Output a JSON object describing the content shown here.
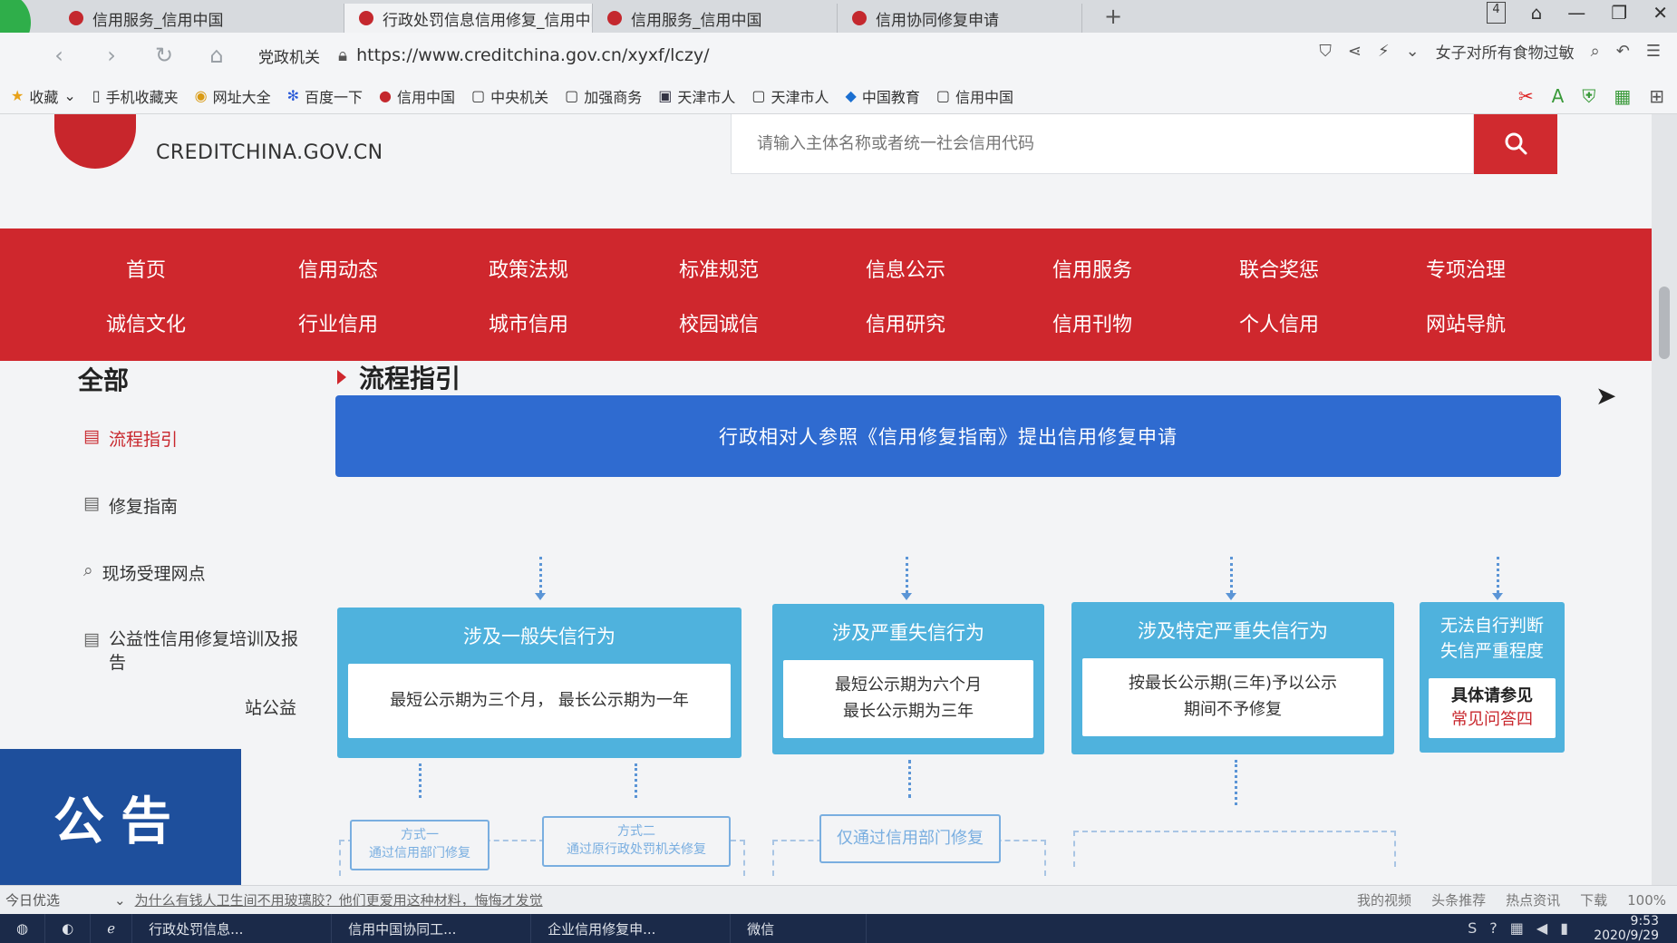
{
  "tabs": [
    {
      "label": "信用服务_信用中国",
      "active": false
    },
    {
      "label": "行政处罚信息信用修复_信用中国",
      "active": true,
      "close": "×"
    },
    {
      "label": "信用服务_信用中国",
      "active": false
    },
    {
      "label": "信用协同修复申请",
      "active": false
    }
  ],
  "new_tab": "+",
  "window": {
    "tab_count": "4"
  },
  "address": {
    "tag": "党政机关",
    "url": "https://www.creditchina.gov.cn/xyxf/lczy/",
    "search_hint": "女子对所有食物过敏"
  },
  "bookmarks": [
    "收藏",
    "手机收藏夹",
    "网址大全",
    "百度一下",
    "信用中国",
    "中央机关",
    "加强商务",
    "天津市人",
    "天津市人",
    "中国教育",
    "信用中国"
  ],
  "site": {
    "domain": "CREDITCHINA.GOV.CN"
  },
  "search": {
    "placeholder": "请输入主体名称或者统一社会信用代码"
  },
  "nav_row1": [
    "首页",
    "信用动态",
    "政策法规",
    "标准规范",
    "信息公示",
    "信用服务",
    "联合奖惩",
    "专项治理"
  ],
  "nav_row2": [
    "诚信文化",
    "行业信用",
    "城市信用",
    "校园诚信",
    "信用研究",
    "信用刊物",
    "个人信用",
    "网站导航"
  ],
  "sidebar": {
    "title": "全部",
    "items": [
      "流程指引",
      "修复指南",
      "现场受理网点",
      "公益性信用修复培训及报告",
      "站公益"
    ]
  },
  "notice": "公告",
  "section_title": "流程指引",
  "flow": {
    "top": "行政相对人参照《信用修复指南》提出信用修复申请",
    "categories": [
      {
        "title": "涉及一般失信行为",
        "body": "最短公示期为三个月， 最长公示期为一年"
      },
      {
        "title": "涉及严重失信行为",
        "body1": "最短公示期为六个月",
        "body2": "最长公示期为三年"
      },
      {
        "title": "涉及特定严重失信行为",
        "body1": "按最长公示期(三年)予以公示",
        "body2": "期间不予修复"
      },
      {
        "title1": "无法自行判断",
        "title2": "失信严重程度",
        "body1": "具体请参见",
        "body2": "常见问答四"
      }
    ],
    "methods": [
      {
        "line1": "方式一",
        "line2": "通过信用部门修复"
      },
      {
        "line1": "方式二",
        "line2": "通过原行政处罚机关修复"
      },
      {
        "line1": "仅通过信用部门修复"
      }
    ]
  },
  "status_bar": {
    "today": "今日优选",
    "news": "为什么有钱人卫生间不用玻璃胶？他们更爱用这种材料，悔悔才发觉",
    "items": [
      "我的视频",
      "头条推荐",
      "热点资讯",
      "下载",
      "100%"
    ]
  },
  "taskbar": {
    "items": [
      "行政处罚信息...",
      "信用中国协同工...",
      "企业信用修复申...",
      "微信"
    ],
    "time": "9:53",
    "date": "2020/9/29"
  }
}
